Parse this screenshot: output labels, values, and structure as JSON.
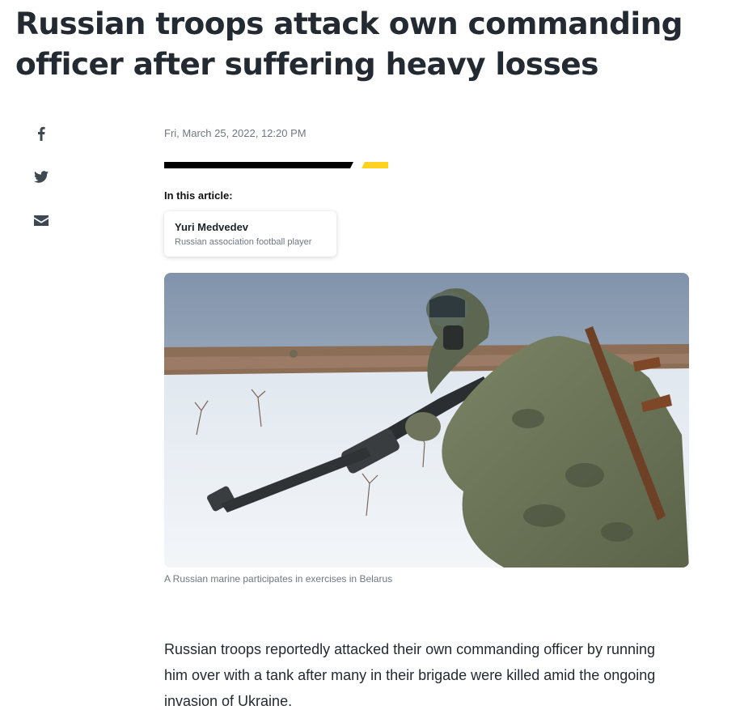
{
  "article": {
    "headline": "Russian troops attack own commanding officer after suffering heavy losses",
    "timestamp": "Fri, March 25, 2022, 12:20 PM",
    "in_this_article_label": "In this article:",
    "entity": {
      "name": "Yuri Medvedev",
      "description": "Russian association football player"
    },
    "image_caption": "A Russian marine participates in exercises in Belarus",
    "body_paragraph": "Russian troops reportedly attacked their own commanding officer by running him over with a tank after many in their brigade were killed amid the ongoing invasion of Ukraine."
  },
  "share": {
    "icons": [
      "facebook-icon",
      "twitter-icon",
      "mail-icon"
    ]
  },
  "colors": {
    "text": "#232a31",
    "meta": "#6e7780",
    "accent_yellow": "#ffd21f",
    "bar_black": "#000000"
  }
}
